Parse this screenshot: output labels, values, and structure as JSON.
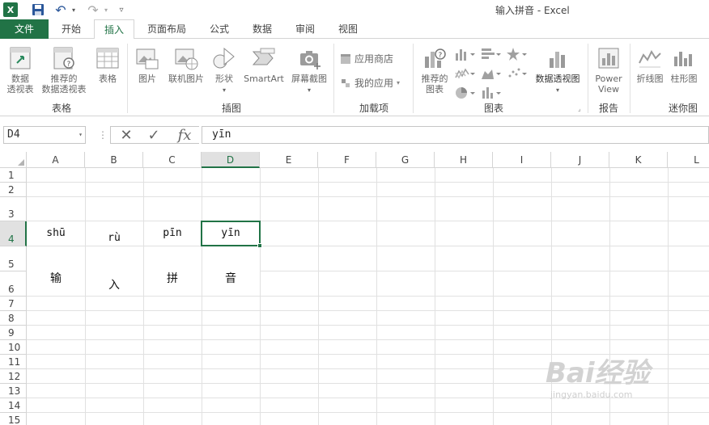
{
  "app": {
    "title": "输入拼音 - Excel",
    "logo_text": "X",
    "icons": {
      "save": "save-icon",
      "undo": "undo-icon",
      "redo": "redo-icon"
    }
  },
  "tabs": {
    "file": "文件",
    "home": "开始",
    "insert": "插入",
    "page_layout": "页面布局",
    "formulas": "公式",
    "data": "数据",
    "review": "审阅",
    "view": "视图",
    "active": "insert"
  },
  "ribbon": {
    "tables": {
      "group_label": "表格",
      "pivot_table": [
        "数据",
        "透视表"
      ],
      "recommended_pivot": [
        "推荐的",
        "数据透视表"
      ],
      "table": "表格"
    },
    "illustrations": {
      "group_label": "插图",
      "pictures": "图片",
      "online_pictures": "联机图片",
      "shapes": "形状",
      "smartart": "SmartArt",
      "screenshot": "屏幕截图"
    },
    "addins": {
      "group_label": "加载项",
      "store": "应用商店",
      "my_apps": "我的应用"
    },
    "charts": {
      "group_label": "图表",
      "recommended_charts": [
        "推荐的",
        "图表"
      ],
      "pivot_chart": "数据透视图"
    },
    "reports": {
      "group_label": "报告",
      "power_view": [
        "Power",
        "View"
      ]
    },
    "sparklines": {
      "group_label": "迷你图",
      "line": "折线图",
      "column": "柱形图"
    }
  },
  "formula_bar": {
    "name_box": "D4",
    "formula": "yīn",
    "cancel_icon": "cancel-icon",
    "enter_icon": "check-icon",
    "fx_label": "fx"
  },
  "sheet": {
    "columns": [
      "A",
      "B",
      "C",
      "D",
      "E",
      "F",
      "G",
      "H",
      "I",
      "J",
      "K",
      "L"
    ],
    "rows": [
      "1",
      "2",
      "3",
      "4",
      "5",
      "6",
      "7",
      "8",
      "9",
      "10",
      "11",
      "12",
      "13",
      "14",
      "15"
    ],
    "selected_cell": "D4",
    "cells": {
      "A4": "shū",
      "B4": "rù",
      "C4": "pīn",
      "D4": "yīn",
      "A5": "输",
      "B5": "入",
      "C5": "拼",
      "D5": "音"
    }
  },
  "watermark": {
    "text": "Bai经验",
    "sub": "jingyan.baidu.com"
  },
  "colors": {
    "accent": "#217346",
    "gridline": "#e1e1e1",
    "header_border": "#d4d4d4"
  }
}
